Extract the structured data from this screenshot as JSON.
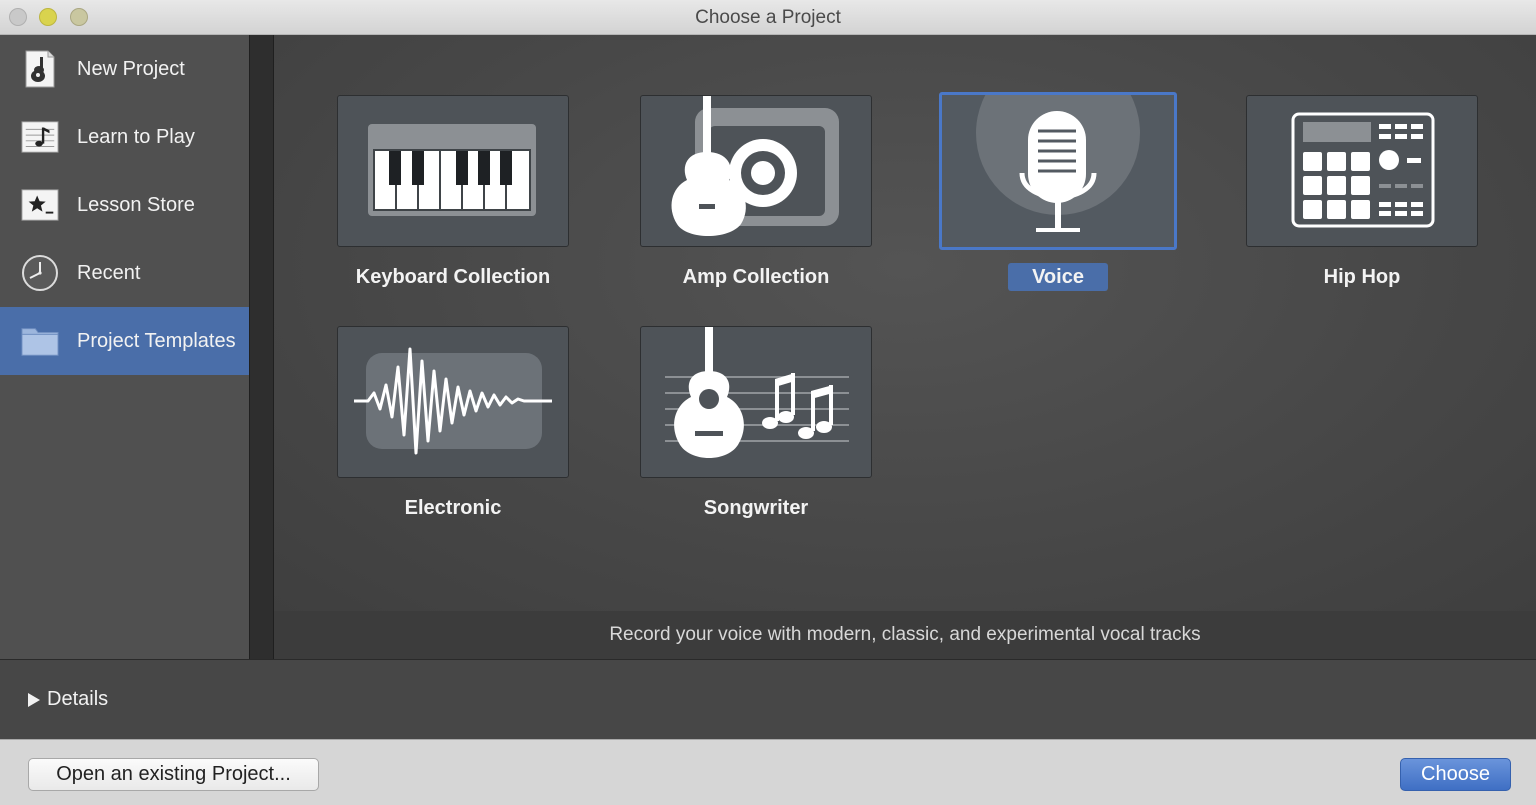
{
  "window": {
    "title": "Choose a Project"
  },
  "sidebar": {
    "items": [
      {
        "label": "New Project",
        "icon": "guitar-doc-icon"
      },
      {
        "label": "Learn to Play",
        "icon": "music-doc-icon"
      },
      {
        "label": "Lesson Store",
        "icon": "star-doc-icon"
      },
      {
        "label": "Recent",
        "icon": "clock-icon"
      },
      {
        "label": "Project Templates",
        "icon": "folder-icon",
        "selected": true
      }
    ]
  },
  "templates": [
    {
      "label": "Keyboard Collection",
      "icon": "keyboard-icon"
    },
    {
      "label": "Amp Collection",
      "icon": "amp-guitar-icon"
    },
    {
      "label": "Voice",
      "icon": "microphone-icon",
      "selected": true
    },
    {
      "label": "Hip Hop",
      "icon": "drum-machine-icon"
    },
    {
      "label": "Electronic",
      "icon": "waveform-icon"
    },
    {
      "label": "Songwriter",
      "icon": "acoustic-guitar-notes-icon"
    }
  ],
  "description": "Record your voice with modern, classic, and experimental vocal tracks",
  "details": {
    "label": "Details"
  },
  "buttons": {
    "open_existing": "Open an existing Project...",
    "choose": "Choose"
  },
  "colors": {
    "selection": "#4a6ea9",
    "accent_button": "#4a78c8"
  }
}
